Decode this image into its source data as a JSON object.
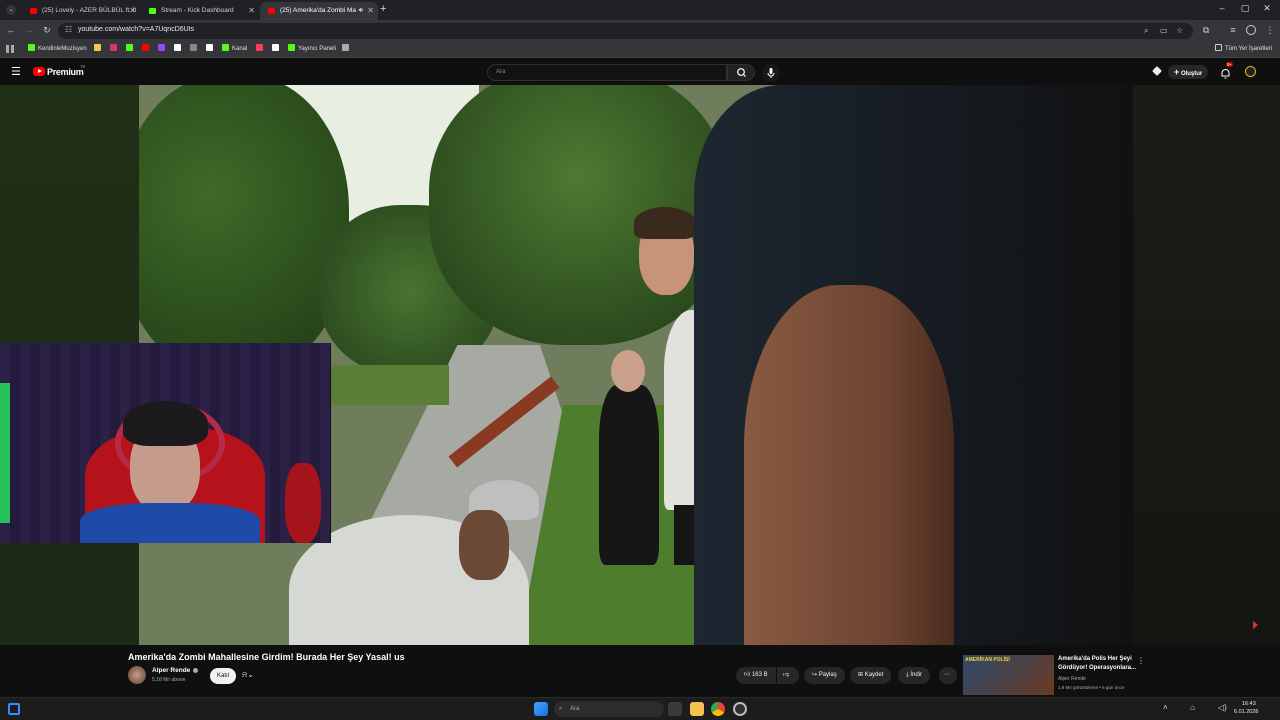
{
  "browser": {
    "tabs": [
      {
        "title": "(25) Lovely - AZER BÜLBÜL ft. İl",
        "favicon": "youtube-icon",
        "color": "#ff0000",
        "active": false
      },
      {
        "title": "Stream - Kick Dashboard",
        "favicon": "kick-icon",
        "color": "#53fc18",
        "active": false
      },
      {
        "title": "(25) Amerika'da Zombi Ma",
        "favicon": "youtube-icon",
        "color": "#ff0000",
        "active": true
      }
    ],
    "url": "youtube.com/watch?v=A7UqncD6Uts",
    "bookmarks": [
      {
        "label": "KendinleMuzisyen",
        "color": "#53fc18"
      },
      {
        "label": "",
        "color": "#f2c94c"
      },
      {
        "label": "",
        "color": "#e1306c"
      },
      {
        "label": "",
        "color": "#53fc18"
      },
      {
        "label": "",
        "color": "#ff0000"
      },
      {
        "label": "",
        "color": "#9146ff"
      },
      {
        "label": "",
        "color": "#ffffff"
      },
      {
        "label": "",
        "color": "#888888"
      },
      {
        "label": "",
        "color": "#ffffff"
      },
      {
        "label": "Kanal",
        "color": "#53fc18"
      },
      {
        "label": "",
        "color": "#ff3b5c"
      },
      {
        "label": "",
        "color": "#ffffff"
      },
      {
        "label": "Yayıncı Paneli",
        "color": "#53fc18"
      },
      {
        "label": "",
        "color": "#aaaaaa"
      }
    ],
    "all_bookmarks": "Tüm Yer İşaretleri"
  },
  "youtube": {
    "logo_text": "Premium",
    "logo_badge": "TR",
    "search_placeholder": "Ara",
    "create_label": "Oluştur",
    "notification_count": "9+"
  },
  "video": {
    "title": "Amerika'da Zombi Mahallesine Girdim! Burada Her Şey Yasal! us",
    "channel_name": "Alper Rende",
    "subscribers": "5,18 Mn abone",
    "join_label": "Katıl",
    "like_count": "163 B",
    "share_label": "Paylaş",
    "save_label": "Kaydet",
    "download_label": "İndir"
  },
  "recommendation": {
    "title_line1": "Amerika'da Polis Her Şeyi",
    "title_line2": "Gördüyor! Operasyonlara...",
    "channel": "Alper Rende",
    "stats": "1,9 Mn görüntüleme • 6 gün önce",
    "thumb_text": "AMERİKAN POLİSİ"
  },
  "taskbar": {
    "search_placeholder": "Ara",
    "time": "16:43",
    "date": "6.01.2026"
  },
  "colors": {
    "yt_red": "#ff0000",
    "kick_green": "#53fc18",
    "bg": "#0f0f0f"
  }
}
